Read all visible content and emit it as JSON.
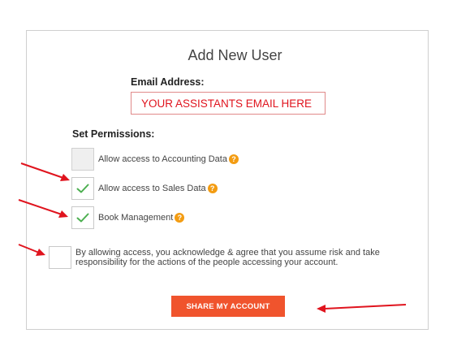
{
  "form": {
    "title": "Add New User",
    "email_label": "Email Address:",
    "email_value": "YOUR ASSISTANTS EMAIL HERE",
    "permissions_label": "Set Permissions:",
    "permissions": [
      {
        "label": "Allow access to Accounting Data",
        "checked": false,
        "disabled": true
      },
      {
        "label": "Allow access to Sales Data",
        "checked": true,
        "disabled": false
      },
      {
        "label": "Book Management",
        "checked": true,
        "disabled": false
      }
    ],
    "help_symbol": "?",
    "agreement_text": "By allowing access, you acknowledge & agree that you assume risk and take responsibility for the actions of the people accessing your account.",
    "agreement_checked": false,
    "submit_label": "SHARE MY ACCOUNT"
  },
  "colors": {
    "accent": "#f0542d",
    "check": "#4caf50",
    "help": "#f39c12",
    "annotation_arrow": "#e0141e",
    "email_text": "#e0141e"
  },
  "annotations": {
    "arrows": [
      "arrow-to-sales-checkbox",
      "arrow-to-book-checkbox",
      "arrow-to-agreement-checkbox",
      "arrow-to-share-button"
    ]
  }
}
